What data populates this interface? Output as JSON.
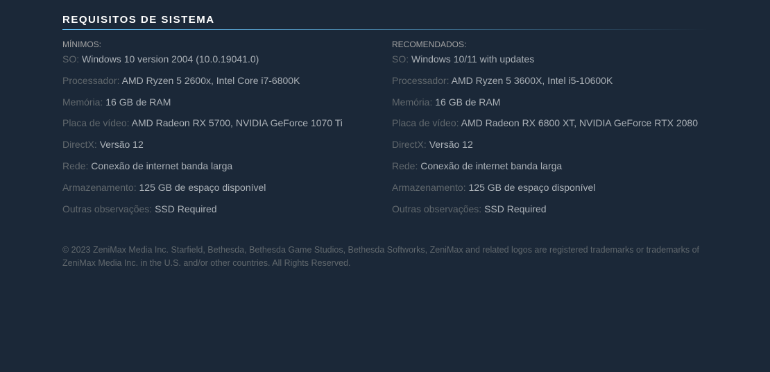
{
  "section_title": "REQUISITOS DE SISTEMA",
  "columns": {
    "minimum": {
      "header": "MÍNIMOS:",
      "specs": [
        {
          "label": "SO:",
          "value": "Windows 10 version 2004 (10.0.19041.0)"
        },
        {
          "label": "Processador:",
          "value": "AMD Ryzen 5 2600x, Intel Core i7-6800K"
        },
        {
          "label": "Memória:",
          "value": "16 GB de RAM"
        },
        {
          "label": "Placa de vídeo:",
          "value": "AMD Radeon RX 5700, NVIDIA GeForce 1070 Ti"
        },
        {
          "label": "DirectX:",
          "value": "Versão 12"
        },
        {
          "label": "Rede:",
          "value": "Conexão de internet banda larga"
        },
        {
          "label": "Armazenamento:",
          "value": "125 GB de espaço disponível"
        },
        {
          "label": "Outras observações:",
          "value": "SSD Required"
        }
      ]
    },
    "recommended": {
      "header": "RECOMENDADOS:",
      "specs": [
        {
          "label": "SO:",
          "value": "Windows 10/11 with updates"
        },
        {
          "label": "Processador:",
          "value": "AMD Ryzen 5 3600X, Intel i5-10600K"
        },
        {
          "label": "Memória:",
          "value": "16 GB de RAM"
        },
        {
          "label": "Placa de vídeo:",
          "value": "AMD Radeon RX 6800 XT, NVIDIA GeForce RTX 2080"
        },
        {
          "label": "DirectX:",
          "value": "Versão 12"
        },
        {
          "label": "Rede:",
          "value": "Conexão de internet banda larga"
        },
        {
          "label": "Armazenamento:",
          "value": "125 GB de espaço disponível"
        },
        {
          "label": "Outras observações:",
          "value": "SSD Required"
        }
      ]
    }
  },
  "legal": "© 2023 ZeniMax Media Inc. Starfield, Bethesda, Bethesda Game Studios, Bethesda Softworks, ZeniMax and related logos are registered trademarks or trademarks of ZeniMax Media Inc. in the U.S. and/or other countries. All Rights Reserved."
}
